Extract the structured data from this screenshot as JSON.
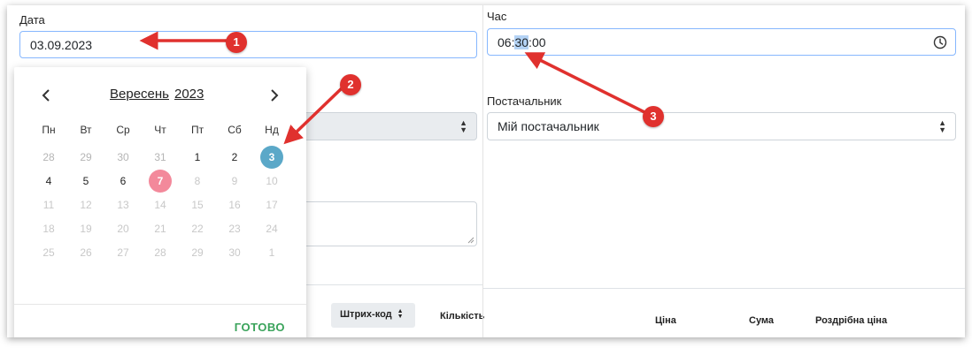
{
  "date": {
    "label": "Дата",
    "value": "03.09.2023"
  },
  "time": {
    "label": "Час",
    "hours": "06",
    "sep1": ":",
    "minutes": "30",
    "sep2": ":",
    "seconds": "00"
  },
  "supplier": {
    "label": "Постачальник",
    "value": "Мій постачальник"
  },
  "table": {
    "sort_button_label": "Штрих-код",
    "col_quantity": "Кількість",
    "col_price": "Ціна",
    "col_sum": "Сума",
    "col_retail": "Роздрібна ціна"
  },
  "calendar": {
    "month": "Вересень",
    "year": "2023",
    "prev_icon": "chevron-left-icon",
    "next_icon": "chevron-right-icon",
    "weekdays": [
      "Пн",
      "Вт",
      "Ср",
      "Чт",
      "Пт",
      "Сб",
      "Нд"
    ],
    "weeks": [
      [
        "28",
        "29",
        "30",
        "31",
        "1",
        "2",
        "3"
      ],
      [
        "4",
        "5",
        "6",
        "7",
        "8",
        "9",
        "10"
      ],
      [
        "11",
        "12",
        "13",
        "14",
        "15",
        "16",
        "17"
      ],
      [
        "18",
        "19",
        "20",
        "21",
        "22",
        "23",
        "24"
      ],
      [
        "25",
        "26",
        "27",
        "28",
        "29",
        "30",
        "1"
      ]
    ],
    "selected_day": "3",
    "today_day": "7",
    "done_label": "ГОТОВО"
  },
  "annotations": [
    "1",
    "2",
    "3"
  ],
  "colors": {
    "badge": "#e0312e",
    "selected": "#5ba8c8",
    "today": "#f3899b",
    "done": "#3aa35b"
  }
}
